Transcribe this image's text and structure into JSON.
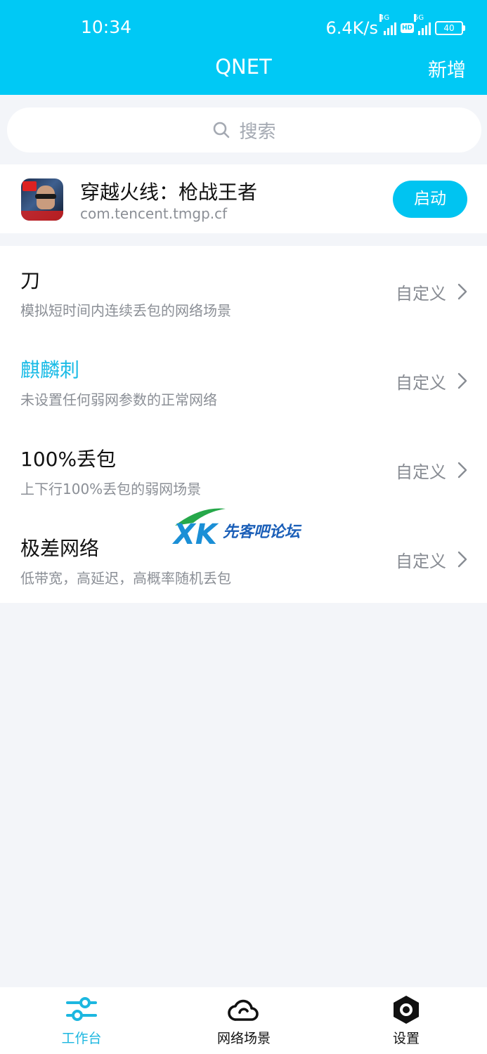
{
  "status_bar": {
    "time": "10:34",
    "net_speed": "6.4K/s",
    "signal1_gen": "4G",
    "hd_badge": "HD",
    "signal2_gen": "5G",
    "battery": "40"
  },
  "header": {
    "title": "QNET",
    "add_label": "新增"
  },
  "search": {
    "placeholder": "搜索",
    "icon": "search-icon"
  },
  "app": {
    "name": "穿越火线：枪战王者",
    "package": "com.tencent.tmgp.cf",
    "launch_label": "启动"
  },
  "scenes": [
    {
      "title": "刀",
      "desc": "模拟短时间内连续丢包的网络场景",
      "action": "自定义",
      "active": false
    },
    {
      "title": "麒麟刺",
      "desc": "未设置任何弱网参数的正常网络",
      "action": "自定义",
      "active": true
    },
    {
      "title": "100%丢包",
      "desc": "上下行100%丢包的弱网场景",
      "action": "自定义",
      "active": false
    },
    {
      "title": "极差网络",
      "desc": "低带宽，高延迟，高概率随机丢包",
      "action": "自定义",
      "active": false
    }
  ],
  "watermark": {
    "logo_text": "XK",
    "site_text": "先客吧论坛"
  },
  "nav": {
    "items": [
      {
        "label": "工作台",
        "icon": "sliders-icon",
        "active": true
      },
      {
        "label": "网络场景",
        "icon": "cloud-icon",
        "active": false
      },
      {
        "label": "设置",
        "icon": "hexagon-settings-icon",
        "active": false
      }
    ]
  },
  "colors": {
    "brand": "#00c9f5",
    "active_text": "#19bbe6",
    "nav_active": "#1cb7e0"
  }
}
